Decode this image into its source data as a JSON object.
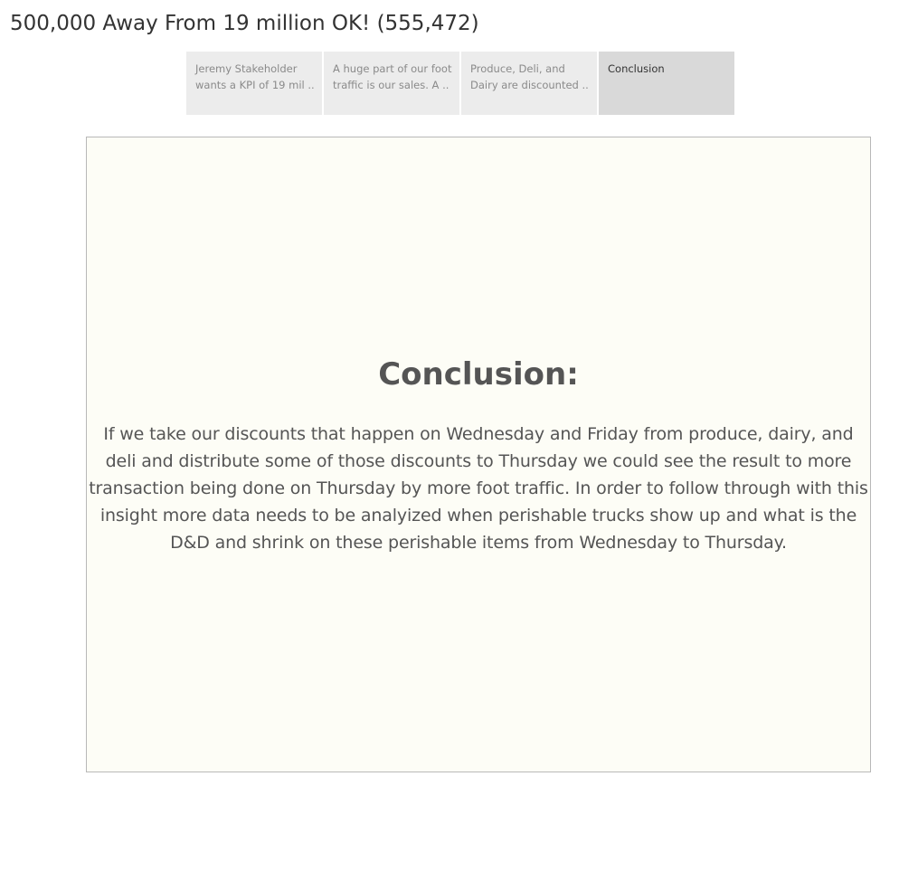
{
  "story": {
    "title": "500,000 Away From 19 million OK! (555,472)"
  },
  "story_points": [
    {
      "caption": "Jeremy Stakeholder wants a KPI of 19 mil ..",
      "active": false
    },
    {
      "caption": "A huge part of our foot traffic is our sales. A ..",
      "active": false
    },
    {
      "caption": "Produce, Deli, and Dairy are discounted ..",
      "active": false
    },
    {
      "caption": "Conclusion",
      "active": true
    }
  ],
  "panel": {
    "heading": "Conclusion:",
    "body": "If we take our discounts that happen on Wednesday and Friday from produce, dairy, and deli and distribute some of those discounts to Thursday we could see the result to more transaction being done on Thursday by more foot traffic. In order to follow through with this insight more data needs to be analyized when perishable trucks show up and what is the D&D and shrink on these perishable items from Wednesday to Thursday.",
    "background_color": "#fdfdf6"
  },
  "colors": {
    "nav_inactive": "#ececec",
    "nav_active": "#d9d9d9"
  }
}
